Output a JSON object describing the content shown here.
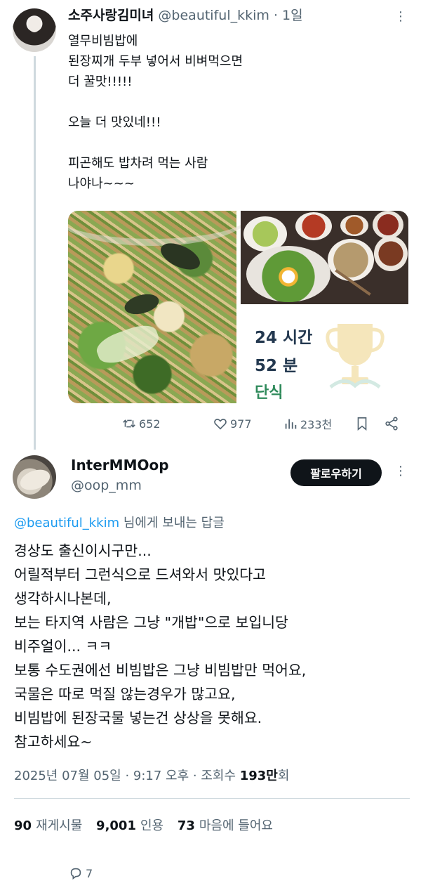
{
  "original_tweet": {
    "display_name": "소주사랑김미녀",
    "handle": "@beautiful_kkim",
    "separator": "·",
    "time": "1일",
    "more_icon": "more-dots-icon",
    "lines": [
      "열무비빔밥에",
      "된장찌개 두부 넣어서 비벼먹으면",
      "더 꿀맛!!!!!",
      "",
      "오늘 더 맛있네!!!",
      "",
      "피곤해도 밥차려 먹는 사람",
      "나야나~~~"
    ],
    "fasting_card": {
      "hours": "24 시간",
      "minutes": "52 분",
      "label": "단식"
    },
    "actions": {
      "replies": "7",
      "retweets": "652",
      "likes": "977",
      "views": "233천"
    }
  },
  "reply_tweet": {
    "display_name": "InterMMOop",
    "handle": "@oop_mm",
    "follow_label": "팔로우하기",
    "replying_mention": "@beautiful_kkim",
    "replying_suffix": " 님에게 보내는 답글",
    "lines": [
      "경상도 출신이시구만...",
      "어릴적부터 그런식으로 드셔와서 맛있다고",
      "생각하시나본데,",
      "보는 타지역 사람은 그냥 \"개밥\"으로 보입니당",
      "비주얼이... ㅋㅋ",
      "보통 수도권에선 비빔밥은 그냥 비빔밥만 먹어요,",
      "국물은 따로 먹질 않는경우가 많고요,",
      "비빔밥에 된장국물 넣는건 상상을 못해요.",
      "참고하세요~"
    ],
    "meta": {
      "timestamp": "2025년 07월 05일 · 9:17 오후 · 조회수 ",
      "views_count": "193만",
      "views_suffix": "회"
    },
    "counts": {
      "retweets": "90",
      "retweets_label": "재게시물",
      "quotes": "9,001",
      "quotes_label": "인용",
      "likes": "73",
      "likes_label": "마음에 들어요"
    }
  },
  "colors": {
    "text": "#0f1419",
    "muted": "#536471",
    "link": "#1d9bf0",
    "divider": "#cfd9de",
    "button_bg": "#0f1419"
  }
}
